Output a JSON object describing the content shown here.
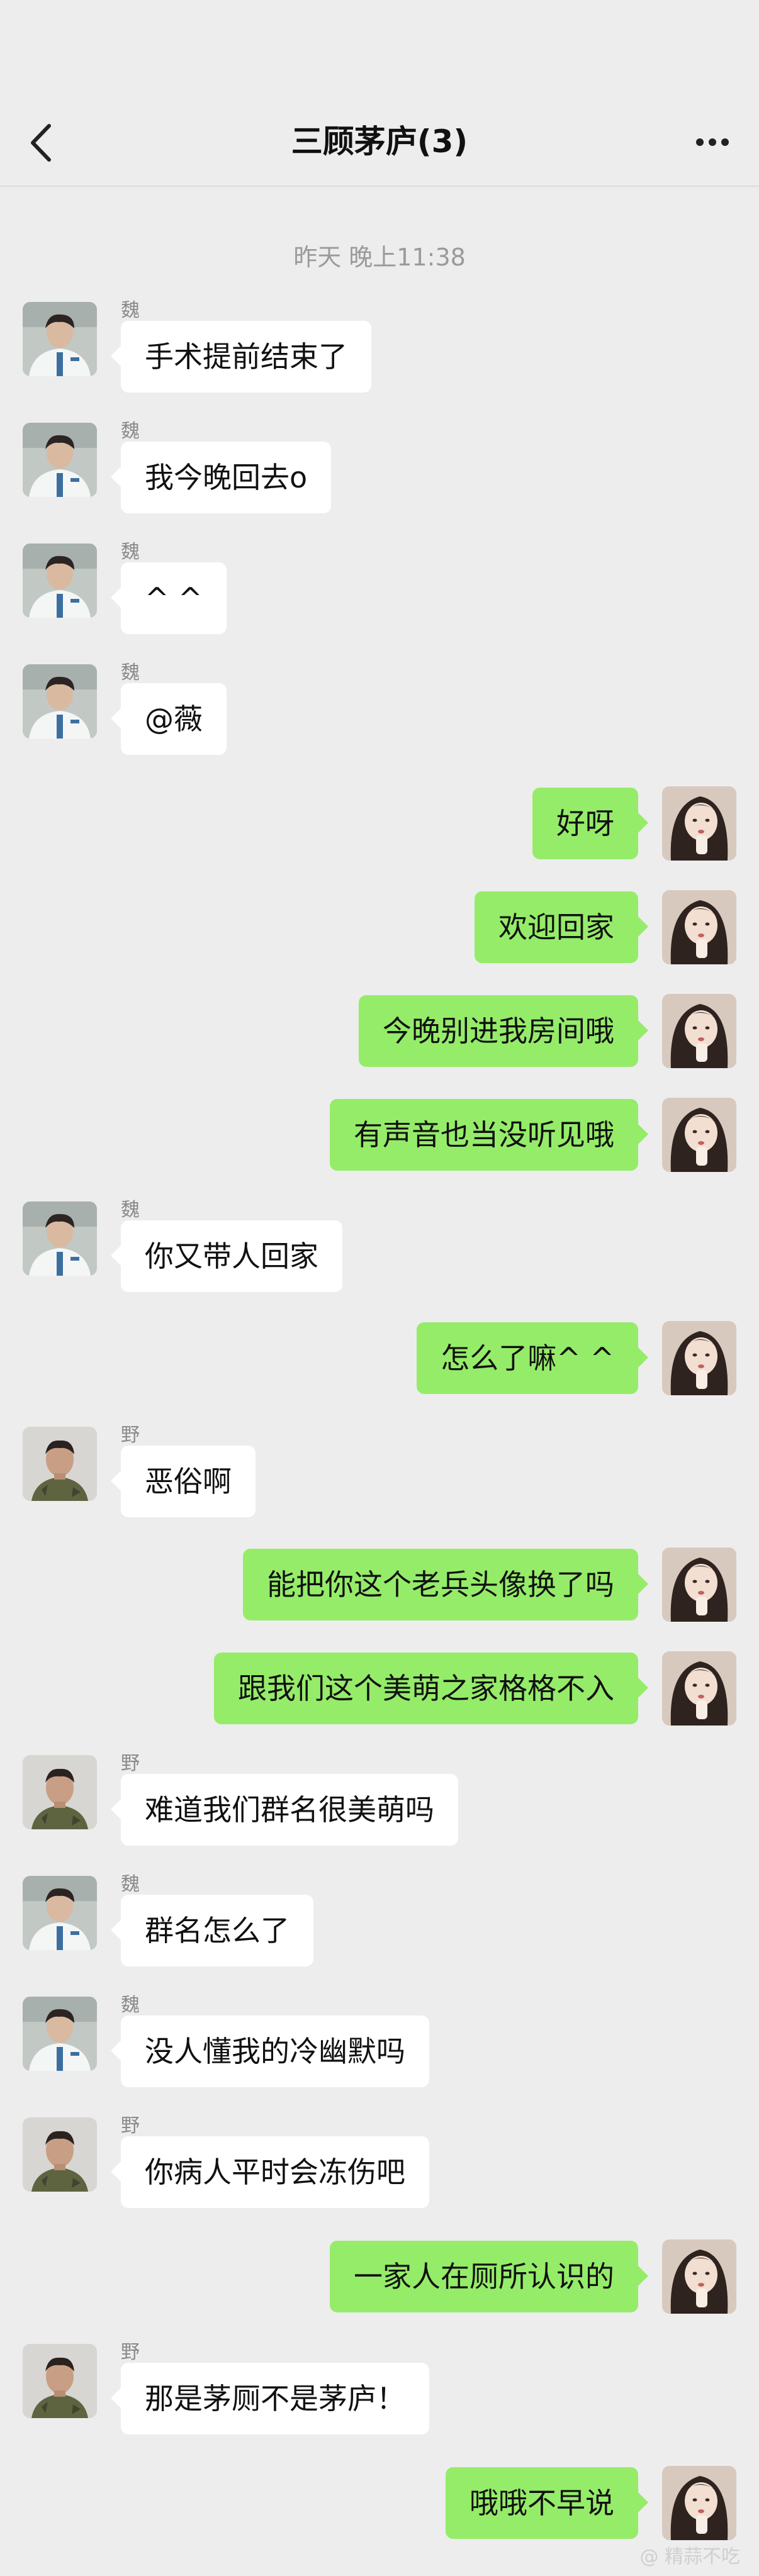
{
  "header": {
    "title": "三顾茅庐(3)",
    "back_icon": "chevron-left-icon",
    "more_icon": "more-horizontal-icon"
  },
  "timestamp": "昨天 晚上11:38",
  "colors": {
    "background": "#ededed",
    "incoming_bubble": "#ffffff",
    "outgoing_bubble": "#95ec69"
  },
  "messages": [
    {
      "side": "left",
      "sender": "魏",
      "avatar": "avatar-wei",
      "text": "手术提前结束了"
    },
    {
      "side": "left",
      "sender": "魏",
      "avatar": "avatar-wei",
      "text": "我今晚回去o"
    },
    {
      "side": "left",
      "sender": "魏",
      "avatar": "avatar-wei",
      "text": "^ ^"
    },
    {
      "side": "left",
      "sender": "魏",
      "avatar": "avatar-wei",
      "text": "@薇"
    },
    {
      "side": "right",
      "sender": "",
      "avatar": "avatar-self",
      "text": "好呀"
    },
    {
      "side": "right",
      "sender": "",
      "avatar": "avatar-self",
      "text": "欢迎回家"
    },
    {
      "side": "right",
      "sender": "",
      "avatar": "avatar-self",
      "text": "今晚别进我房间哦"
    },
    {
      "side": "right",
      "sender": "",
      "avatar": "avatar-self",
      "text": "有声音也当没听见哦"
    },
    {
      "side": "left",
      "sender": "魏",
      "avatar": "avatar-wei",
      "text": "你又带人回家"
    },
    {
      "side": "right",
      "sender": "",
      "avatar": "avatar-self",
      "text": "怎么了嘛^ ^"
    },
    {
      "side": "left",
      "sender": "野",
      "avatar": "avatar-ye",
      "text": "恶俗啊"
    },
    {
      "side": "right",
      "sender": "",
      "avatar": "avatar-self",
      "text": "能把你这个老兵头像换了吗"
    },
    {
      "side": "right",
      "sender": "",
      "avatar": "avatar-self",
      "text": "跟我们这个美萌之家格格不入"
    },
    {
      "side": "left",
      "sender": "野",
      "avatar": "avatar-ye",
      "text": "难道我们群名很美萌吗"
    },
    {
      "side": "left",
      "sender": "魏",
      "avatar": "avatar-wei",
      "text": "群名怎么了"
    },
    {
      "side": "left",
      "sender": "魏",
      "avatar": "avatar-wei",
      "text": "没人懂我的冷幽默吗"
    },
    {
      "side": "left",
      "sender": "野",
      "avatar": "avatar-ye",
      "text": "你病人平时会冻伤吧"
    },
    {
      "side": "right",
      "sender": "",
      "avatar": "avatar-self",
      "text": "一家人在厕所认识的"
    },
    {
      "side": "left",
      "sender": "野",
      "avatar": "avatar-ye",
      "text": "那是茅厕不是茅庐！"
    },
    {
      "side": "right",
      "sender": "",
      "avatar": "avatar-self",
      "text": "哦哦不早说"
    }
  ]
}
